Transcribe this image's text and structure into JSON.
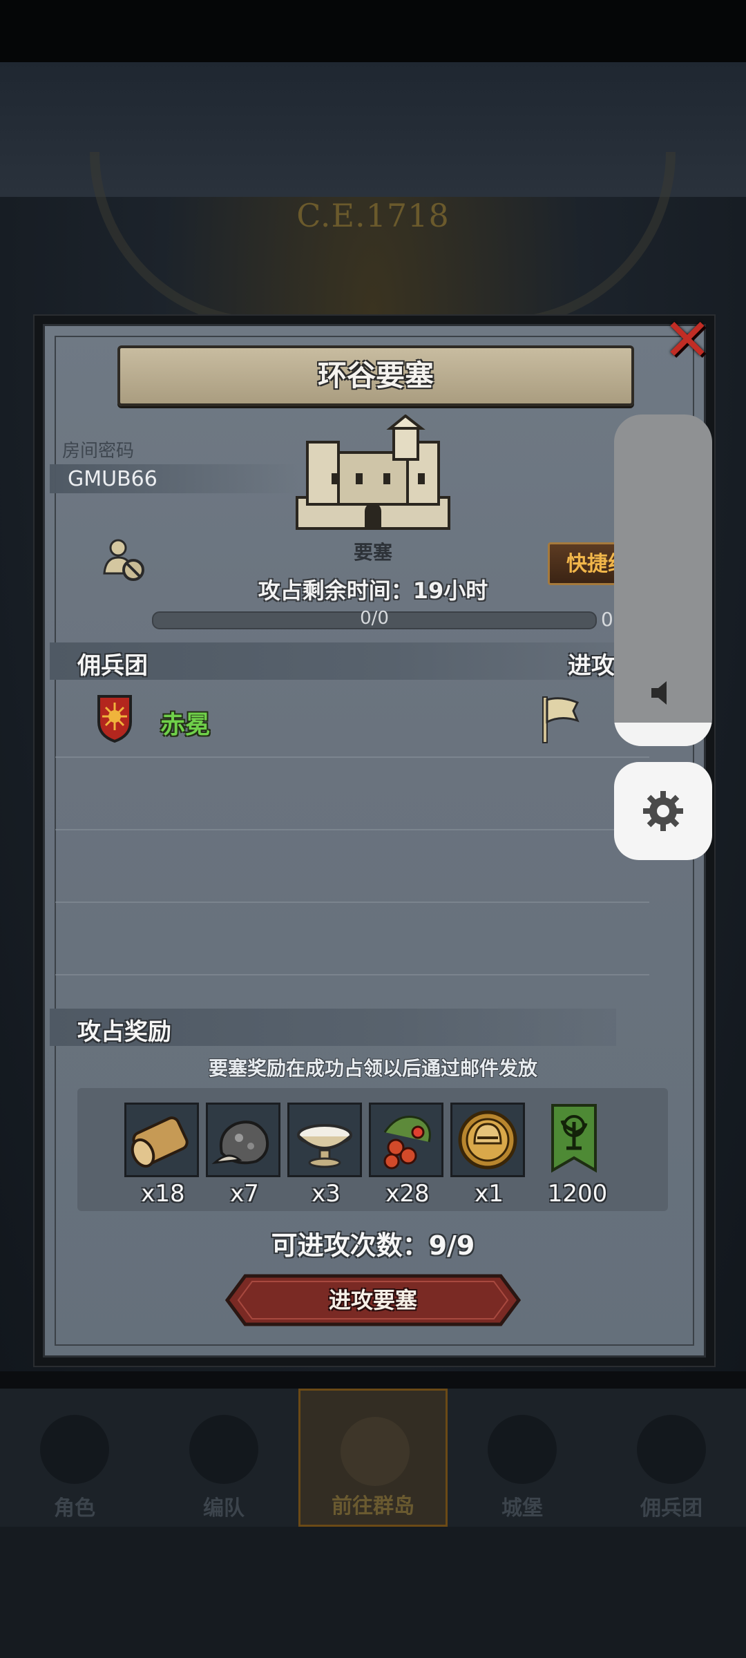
{
  "background": {
    "era_text": "C.E.1718"
  },
  "dialog": {
    "title": "环谷要塞",
    "room_code_label": "房间密码",
    "room_code": "GMUB66",
    "fortress_label": "要塞",
    "timer_text": "攻占剩余时间：19小时",
    "progress_text": "0/0",
    "progress_right": "0",
    "quick_button": "快捷组",
    "mercenary_section": "佣兵团",
    "attack_section": "进攻",
    "mercenaries": [
      {
        "name": "赤冕"
      }
    ],
    "reward_section": "攻占奖励",
    "reward_note": "要塞奖励在成功占领以后通过邮件发放",
    "rewards": [
      {
        "icon": "log-icon",
        "qty": "x18"
      },
      {
        "icon": "ore-icon",
        "qty": "x7"
      },
      {
        "icon": "bowl-icon",
        "qty": "x3"
      },
      {
        "icon": "berries-icon",
        "qty": "x28"
      },
      {
        "icon": "helmet-coin-icon",
        "qty": "x1"
      },
      {
        "icon": "banner-icon",
        "qty": "1200"
      }
    ],
    "attempts_text": "可进攻次数：9/9",
    "attack_button": "进攻要塞"
  },
  "nav": [
    {
      "label": "角色"
    },
    {
      "label": "编队"
    },
    {
      "label": "前往群岛",
      "active": true
    },
    {
      "label": "城堡"
    },
    {
      "label": "佣兵团"
    }
  ],
  "system": {
    "volume_level": 0.07
  },
  "colors": {
    "accent_red": "#c12d25",
    "merc_green": "#6fd04a",
    "gold": "#f1b64a"
  }
}
